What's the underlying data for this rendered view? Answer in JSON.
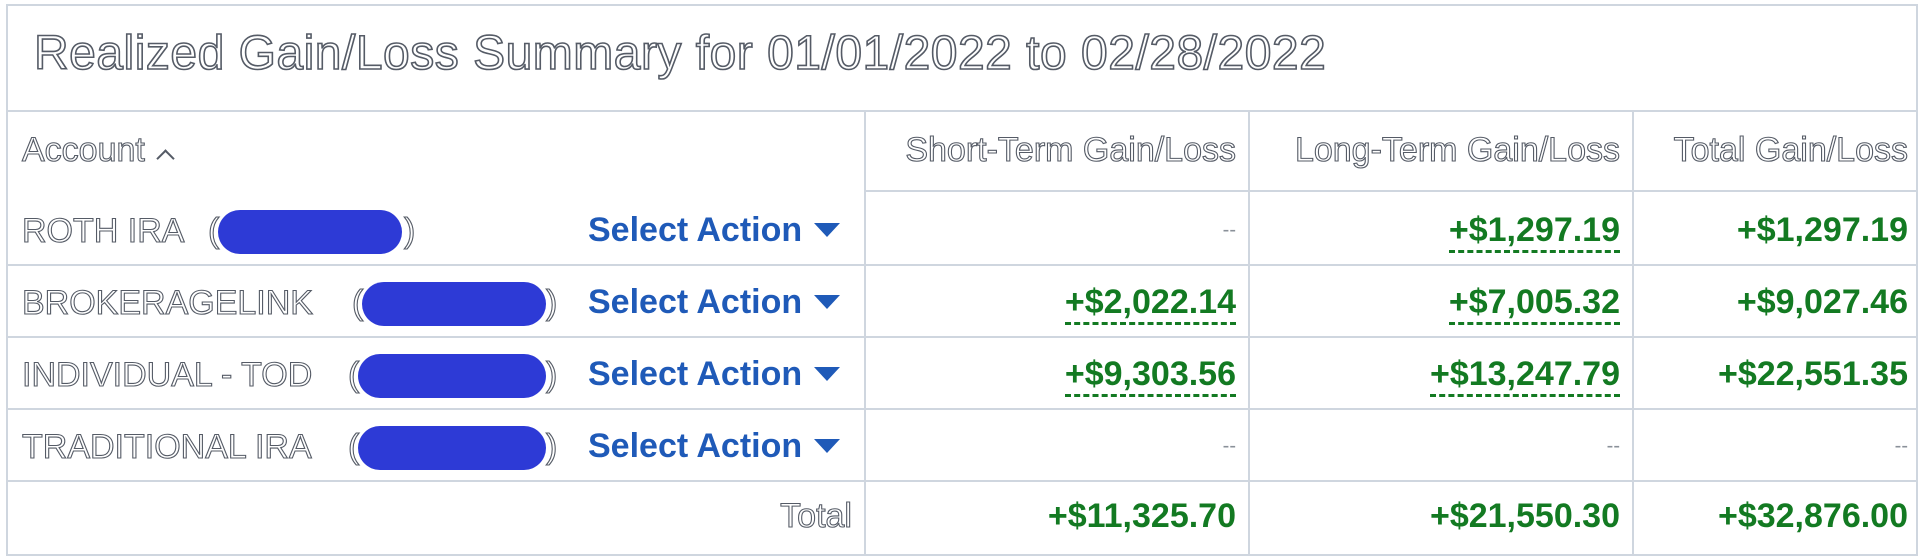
{
  "title": "Realized Gain/Loss Summary for 01/01/2022 to 02/28/2022",
  "headers": {
    "account": "Account",
    "short_term": "Short-Term Gain/Loss",
    "long_term": "Long-Term Gain/Loss",
    "total": "Total Gain/Loss"
  },
  "rows": [
    {
      "account": "ROTH IRA",
      "action": "Select Action",
      "short_term": "--",
      "long_term": "+$1,297.19",
      "total": "+$1,297.19"
    },
    {
      "account": "BROKERAGELINK",
      "action": "Select Action",
      "short_term": "+$2,022.14",
      "long_term": "+$7,005.32",
      "total": "+$9,027.46"
    },
    {
      "account": "INDIVIDUAL - TOD",
      "action": "Select Action",
      "short_term": "+$9,303.56",
      "long_term": "+$13,247.79",
      "total": "+$22,551.35"
    },
    {
      "account": "TRADITIONAL IRA",
      "action": "Select Action",
      "short_term": "--",
      "long_term": "--",
      "total": "--"
    }
  ],
  "totals": {
    "label": "Total",
    "short_term": "+$11,325.70",
    "long_term": "+$21,550.30",
    "total": "+$32,876.00"
  },
  "colors": {
    "gain": "#137a22",
    "link": "#1f5ab8",
    "redaction": "#2d3ad6",
    "border": "#cfd6df"
  }
}
